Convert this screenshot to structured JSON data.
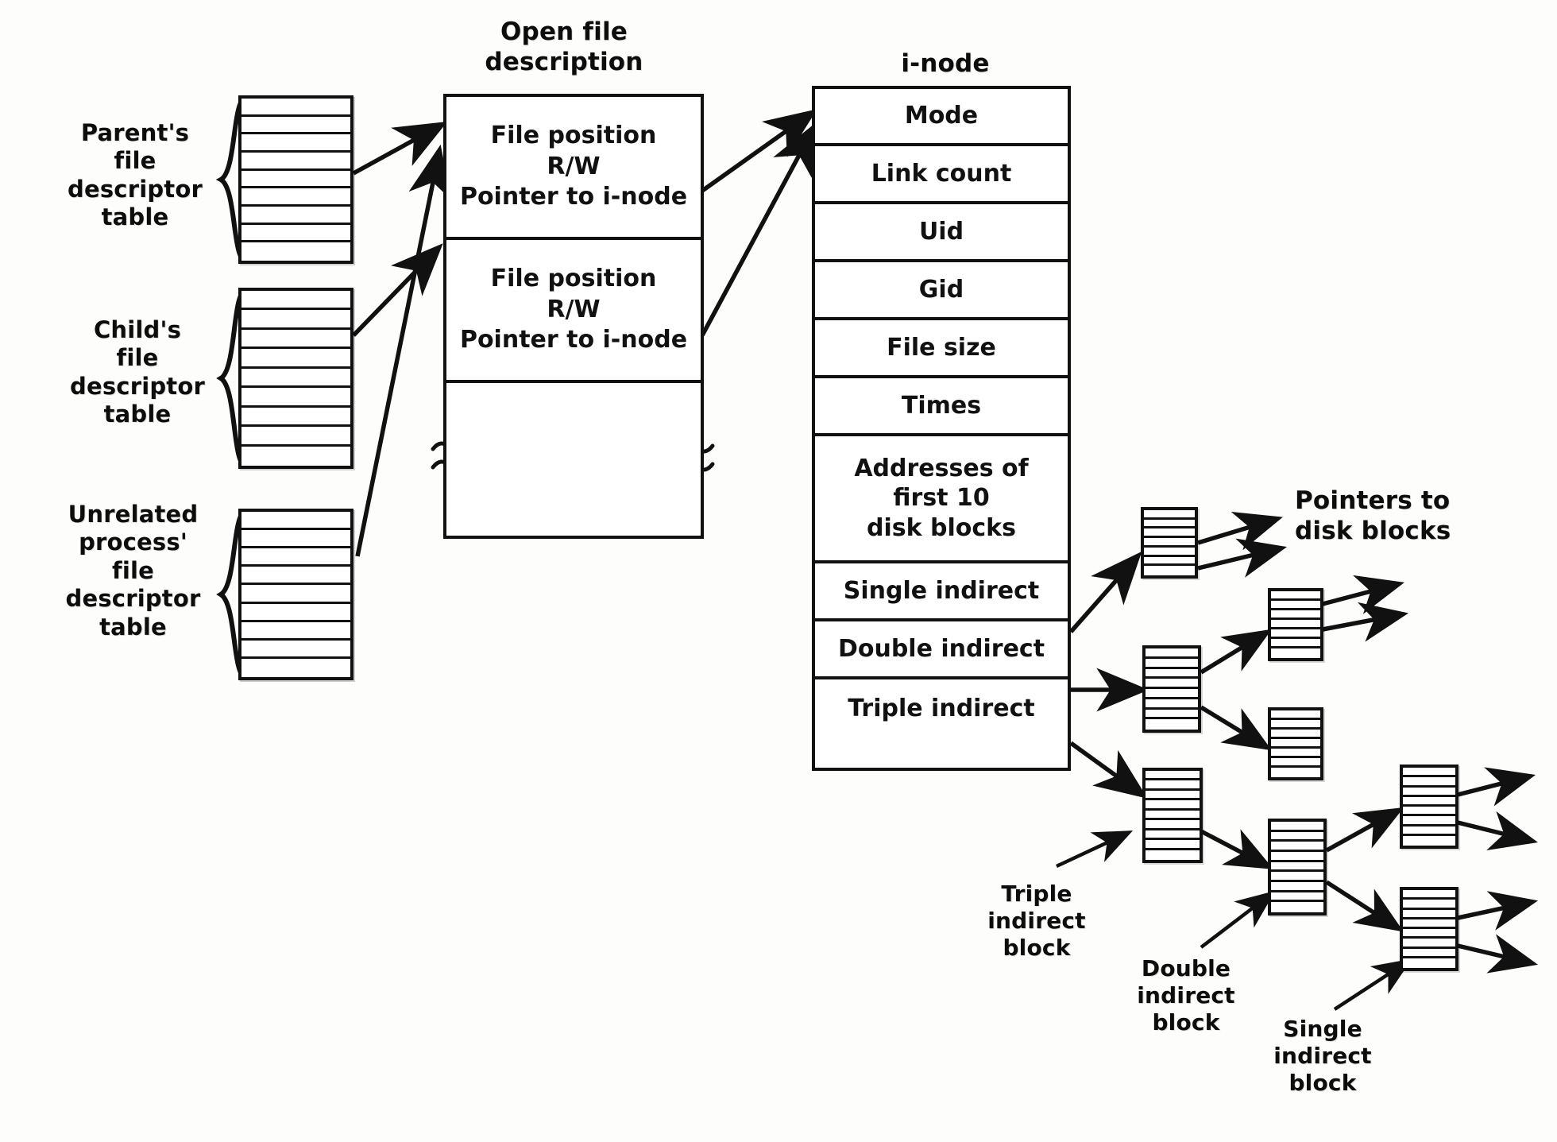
{
  "diagram": {
    "title_open_file_description": "Open file\ndescription",
    "title_inode": "i-node",
    "pointers_to_disk_blocks": "Pointers to\ndisk blocks"
  },
  "descriptor_tables": [
    {
      "label": "Parent's\nfile\ndescriptor\ntable",
      "slots": 9
    },
    {
      "label": "Child's\nfile\ndescriptor\ntable",
      "slots": 9
    },
    {
      "label": "Unrelated\nprocess'\nfile\ndescriptor\ntable",
      "slots": 9
    }
  ],
  "open_file_description": {
    "entries": [
      {
        "line1": "File position",
        "line2": "R/W",
        "line3": "Pointer to i-node"
      },
      {
        "line1": "File position",
        "line2": "R/W",
        "line3": "Pointer to i-node"
      }
    ],
    "break_symbol": "≈"
  },
  "inode": {
    "rows": [
      "Mode",
      "Link count",
      "Uid",
      "Gid",
      "File size",
      "Times",
      "Addresses of\nfirst 10\ndisk blocks",
      "Single indirect",
      "Double indirect",
      "Triple indirect"
    ]
  },
  "block_labels": {
    "triple": "Triple\nindirect\nblock",
    "double": "Double\nindirect\nblock",
    "single": "Single\nindirect\nblock"
  },
  "colors": {
    "ink": "#111111",
    "paper": "#fdfdfb"
  }
}
